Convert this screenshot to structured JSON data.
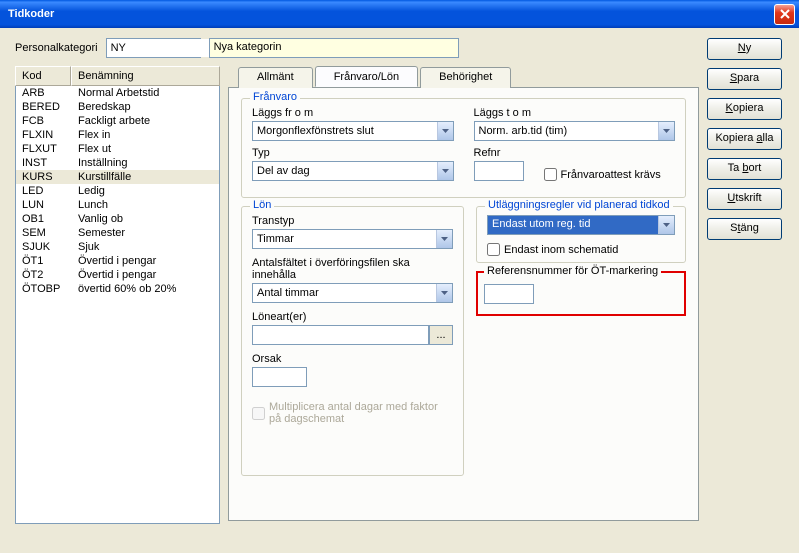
{
  "window": {
    "title": "Tidkoder"
  },
  "top": {
    "personal_label": "Personalkategori",
    "personal_value": "NY",
    "name_value": "Nya kategorin"
  },
  "list": {
    "headers": {
      "kod": "Kod",
      "ben": "Benämning"
    },
    "rows": [
      {
        "kod": "ARB",
        "ben": "Normal Arbetstid"
      },
      {
        "kod": "BERED",
        "ben": "Beredskap"
      },
      {
        "kod": "FCB",
        "ben": "Fackligt arbete"
      },
      {
        "kod": "FLXIN",
        "ben": "Flex in"
      },
      {
        "kod": "FLXUT",
        "ben": "Flex ut"
      },
      {
        "kod": "INST",
        "ben": "Inställning"
      },
      {
        "kod": "KURS",
        "ben": "Kurstillfälle"
      },
      {
        "kod": "LED",
        "ben": "Ledig"
      },
      {
        "kod": "LUN",
        "ben": "Lunch"
      },
      {
        "kod": "OB1",
        "ben": "Vanlig ob"
      },
      {
        "kod": "SEM",
        "ben": "Semester"
      },
      {
        "kod": "SJUK",
        "ben": "Sjuk"
      },
      {
        "kod": "ÖT1",
        "ben": "Övertid i pengar"
      },
      {
        "kod": "ÖT2",
        "ben": "Övertid i pengar"
      },
      {
        "kod": "ÖTOBP",
        "ben": "övertid 60% ob 20%"
      }
    ],
    "selected_index": 6
  },
  "tabs": {
    "general": "Allmänt",
    "absence": "Frånvaro/Lön",
    "auth": "Behörighet"
  },
  "franvaro": {
    "group": "Frånvaro",
    "from_label": "Läggs fr o m",
    "from_value": "Morgonflexfönstrets slut",
    "to_label": "Läggs t o m",
    "to_value": "Norm. arb.tid (tim)",
    "typ_label": "Typ",
    "typ_value": "Del av dag",
    "refnr_label": "Refnr",
    "refnr_value": "",
    "attest_label": "Frånvaroattest krävs"
  },
  "lon": {
    "group": "Lön",
    "transtyp_label": "Transtyp",
    "transtyp_value": "Timmar",
    "antal_label": "Antalsfältet i överföringsfilen ska innehålla",
    "antal_value": "Antal timmar",
    "loneart_label": "Löneart(er)",
    "loneart_value": "",
    "orsak_label": "Orsak",
    "orsak_value": "",
    "multi_label": "Multiplicera antal dagar med faktor på dagschemat"
  },
  "utl": {
    "group": "Utläggningsregler vid planerad tidkod",
    "sel_value": "Endast utom reg. tid",
    "check_label": "Endast inom schematid"
  },
  "refot": {
    "title": "Referensnummer för ÖT-markering",
    "value": ""
  },
  "buttons": {
    "ny": "Ny",
    "spara": "Spara",
    "kopiera": "Kopiera",
    "kopiera_alla": "Kopiera alla",
    "tabort": "Ta bort",
    "utskrift": "Utskrift",
    "stang": "Stäng"
  }
}
